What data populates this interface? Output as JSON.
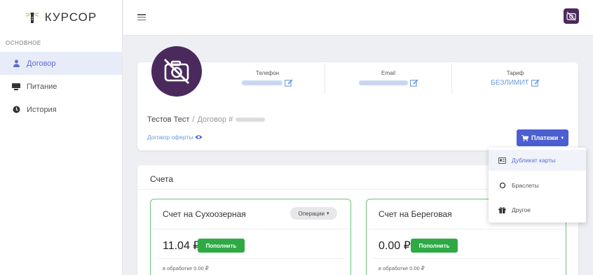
{
  "brand": {
    "name": "КУРСОР"
  },
  "sidebar": {
    "section": "ОСНОВНОЕ",
    "items": [
      {
        "label": "Договор",
        "icon": "user-icon",
        "active": true
      },
      {
        "label": "Питание",
        "icon": "food-icon",
        "active": false
      },
      {
        "label": "История",
        "icon": "clock-icon",
        "active": false
      }
    ]
  },
  "contract": {
    "phone_label": "Телефон",
    "email_label": "Email",
    "tariff_label": "Тариф",
    "tariff_value": "БЕЗЛИМИТ",
    "owner_name": "Тестов Тест",
    "separator": "/",
    "contract_prefix": "Договор #",
    "offer_link": "Договор оферты",
    "payments_button": "Платежи"
  },
  "payments_menu": {
    "items": [
      {
        "label": "Дубликат карты",
        "icon": "id-card-icon"
      },
      {
        "label": "Браслеты",
        "icon": "ring-icon"
      },
      {
        "label": "Другое",
        "icon": "gift-icon"
      }
    ]
  },
  "accounts": {
    "title": "Счета",
    "list": [
      {
        "name": "Счет на Сухоозерная",
        "balance": "11.04 ₽",
        "refill": "Пополнить",
        "processing": "в обработке 0.00 ₽",
        "ops": "Операции"
      },
      {
        "name": "Счет на Береговая",
        "balance": "0.00 ₽",
        "refill": "Пополнить",
        "processing": "в обработке 0.00 ₽"
      }
    ]
  },
  "colors": {
    "accent": "#4b5fd1",
    "success": "#2eaa44",
    "avatar_bg": "#4a2a5c",
    "link": "#6a9be0"
  }
}
